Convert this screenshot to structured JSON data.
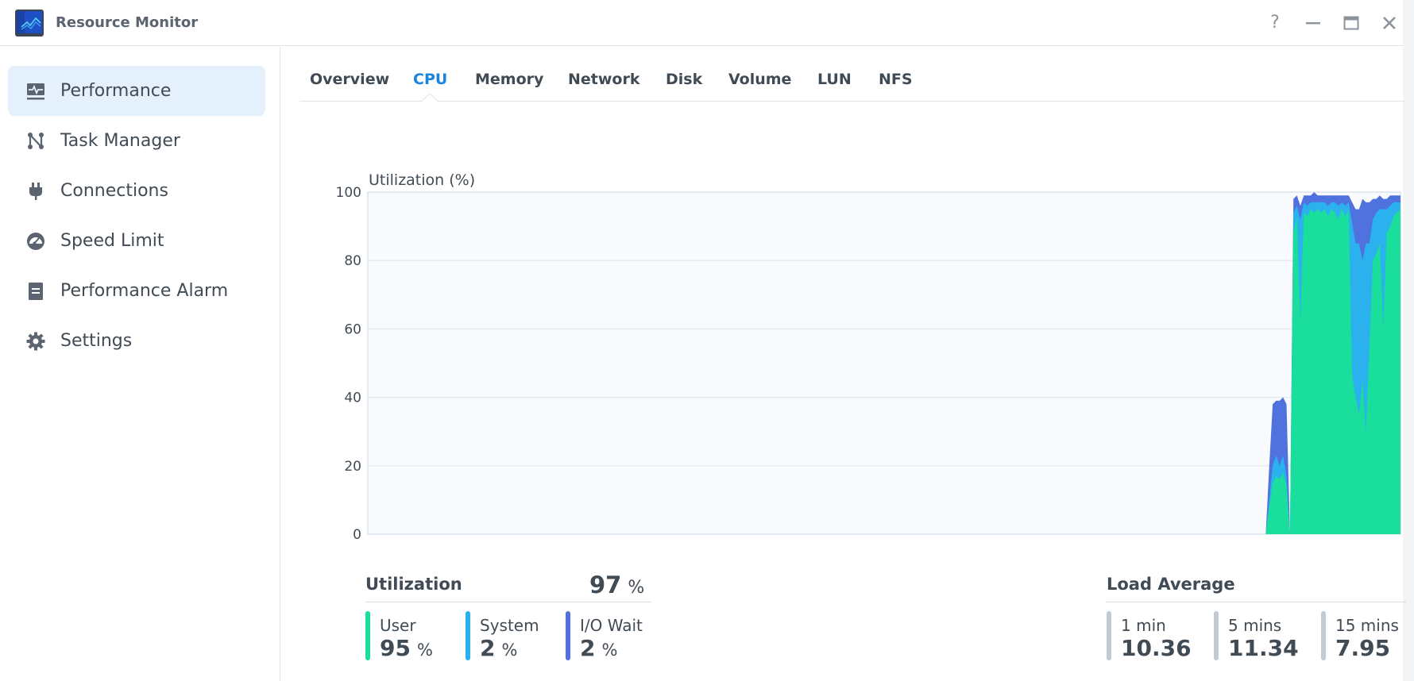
{
  "window": {
    "title": "Resource Monitor",
    "controls": {
      "help": "?",
      "minimize": "—",
      "maximize": "▭",
      "close": "✕"
    }
  },
  "sidebar": {
    "items": [
      {
        "label": "Performance",
        "icon": "performance-icon",
        "active": true
      },
      {
        "label": "Task Manager",
        "icon": "task-manager-icon",
        "active": false
      },
      {
        "label": "Connections",
        "icon": "plug-icon",
        "active": false
      },
      {
        "label": "Speed Limit",
        "icon": "gauge-icon",
        "active": false
      },
      {
        "label": "Performance Alarm",
        "icon": "alarm-clipboard-icon",
        "active": false
      },
      {
        "label": "Settings",
        "icon": "gear-icon",
        "active": false
      }
    ]
  },
  "tabs": [
    {
      "label": "Overview",
      "active": false
    },
    {
      "label": "CPU",
      "active": true
    },
    {
      "label": "Memory",
      "active": false
    },
    {
      "label": "Network",
      "active": false
    },
    {
      "label": "Disk",
      "active": false
    },
    {
      "label": "Volume",
      "active": false
    },
    {
      "label": "LUN",
      "active": false
    },
    {
      "label": "NFS",
      "active": false
    }
  ],
  "colors": {
    "user": "#1ade9b",
    "system": "#2bb1ee",
    "iowait": "#4f72df",
    "accent": "#1d84de",
    "load_bar": "#c2cad4"
  },
  "utilization": {
    "title": "Utilization",
    "total": "97",
    "unit": "%",
    "breakdown": [
      {
        "label": "User",
        "value": "95",
        "unit": "%"
      },
      {
        "label": "System",
        "value": "2",
        "unit": "%"
      },
      {
        "label": "I/O Wait",
        "value": "2",
        "unit": "%"
      }
    ]
  },
  "load_average": {
    "title": "Load Average",
    "items": [
      {
        "label": "1 min",
        "value": "10.36"
      },
      {
        "label": "5 mins",
        "value": "11.34"
      },
      {
        "label": "15 mins",
        "value": "7.95"
      }
    ]
  },
  "chart_data": {
    "type": "area",
    "stacked": true,
    "title": "Utilization (%)",
    "xlabel": "",
    "ylabel": "Utilization (%)",
    "ylim": [
      0,
      100
    ],
    "yticks": [
      0,
      20,
      40,
      60,
      80,
      100
    ],
    "grid": true,
    "sample_count": 300,
    "leading_zero_samples": 261,
    "series_names": [
      "User",
      "System",
      "I/O Wait"
    ],
    "tail_samples": [
      [
        8,
        2,
        10
      ],
      [
        15,
        5,
        18
      ],
      [
        17,
        6,
        16
      ],
      [
        16,
        4,
        19
      ],
      [
        18,
        5,
        17
      ],
      [
        14,
        3,
        21
      ],
      [
        0,
        0,
        0
      ],
      [
        88,
        6,
        4
      ],
      [
        93,
        3,
        3
      ],
      [
        62,
        30,
        4
      ],
      [
        94,
        3,
        2
      ],
      [
        93,
        3,
        3
      ],
      [
        95,
        2,
        2
      ],
      [
        94,
        3,
        3
      ],
      [
        95,
        2,
        2
      ],
      [
        94,
        3,
        2
      ],
      [
        95,
        2,
        2
      ],
      [
        93,
        3,
        3
      ],
      [
        95,
        2,
        2
      ],
      [
        94,
        3,
        2
      ],
      [
        92,
        4,
        3
      ],
      [
        95,
        2,
        2
      ],
      [
        93,
        3,
        3
      ],
      [
        95,
        2,
        2
      ],
      [
        46,
        45,
        6
      ],
      [
        40,
        45,
        10
      ],
      [
        35,
        50,
        10
      ],
      [
        45,
        35,
        18
      ],
      [
        30,
        55,
        12
      ],
      [
        55,
        30,
        12
      ],
      [
        80,
        12,
        6
      ],
      [
        82,
        12,
        4
      ],
      [
        85,
        10,
        4
      ],
      [
        60,
        35,
        3
      ],
      [
        88,
        7,
        3
      ],
      [
        90,
        6,
        3
      ],
      [
        93,
        4,
        2
      ],
      [
        94,
        3,
        2
      ],
      [
        95,
        2,
        2
      ]
    ]
  }
}
